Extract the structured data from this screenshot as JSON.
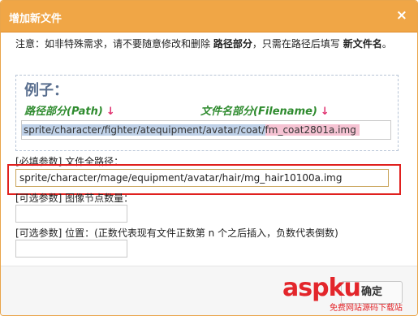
{
  "dialog": {
    "title": "增加新文件",
    "close_symbol": "×"
  },
  "note": {
    "prefix": "注意：如非特殊需求，请不要随意修改和删除",
    "path_part": "路径部分",
    "middle": "，只需在路径后填写",
    "file_part": "新文件名",
    "suffix": "。"
  },
  "example": {
    "title": "例子：",
    "path_label": "路径部分(Path)",
    "file_label": "文件名部分(Filename)",
    "arrow": "↓",
    "path_value": "sprite/character/fighter/atequipment/avatar/coat/",
    "file_value": "fm_coat2801a.img"
  },
  "fields": {
    "full_path_label": "[必填参数] 文件全路径：",
    "full_path_value": "sprite/character/mage/equipment/avatar/hair/mg_hair10100a.img",
    "node_count_label": "[可选参数] 图像节点数量：",
    "position_label": "[可选参数] 位置：(正数代表现有文件正数第 n 个之后插入，负数代表倒数)"
  },
  "footer": {
    "confirm_label": "确定"
  },
  "watermark": {
    "logo": "aspku",
    "subtext": "免费网站源码下载站"
  },
  "colors": {
    "title_bar": "#f0a646",
    "highlight_border": "#e0201e",
    "example_green": "#2e8b2e",
    "arrow_pink": "#e0306e",
    "path_highlight": "#bfd1e8",
    "file_highlight": "#f6c3d3"
  }
}
